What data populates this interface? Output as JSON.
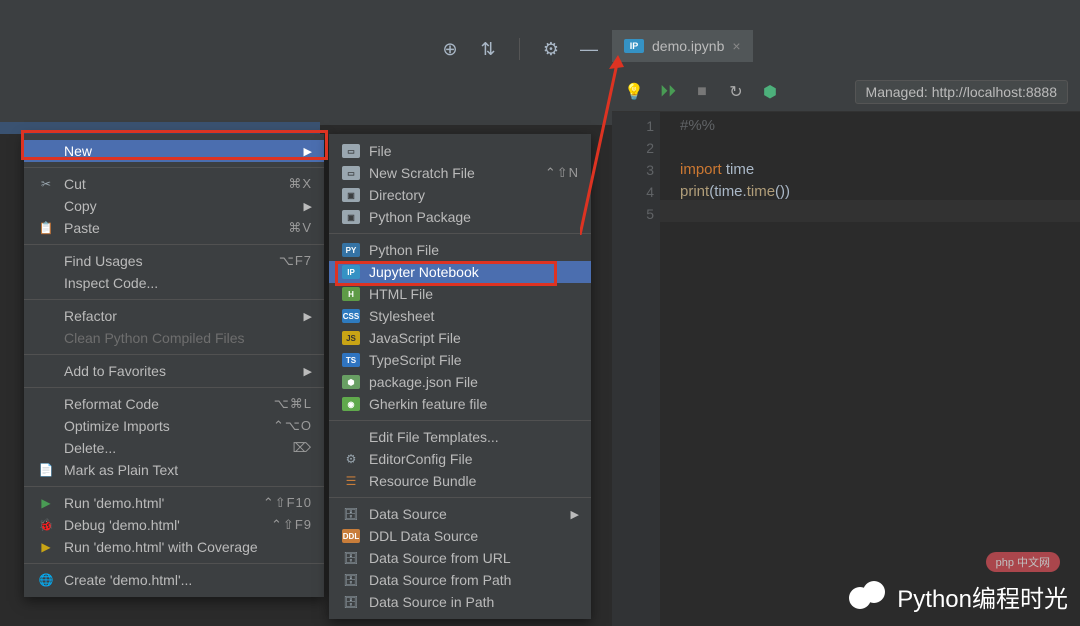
{
  "tab": {
    "filename": "demo.ipynb"
  },
  "managed": "Managed: http://localhost:8888",
  "code": {
    "line1": "#%%",
    "line3_kw": "import",
    "line3_mod": " time",
    "line4_fn": "print",
    "line4_open": "(",
    "line4_a": "time",
    "line4_dot1": ".",
    "line4_b": "time",
    "line4_call": "()",
    "line4_close": ")"
  },
  "lines": {
    "l1": "1",
    "l2": "2",
    "l3": "3",
    "l4": "4",
    "l5": "5"
  },
  "menu1": {
    "new": "New",
    "cut": "Cut",
    "cut_sc": "⌘X",
    "copy": "Copy",
    "paste": "Paste",
    "paste_sc": "⌘V",
    "find": "Find Usages",
    "find_sc": "⌥F7",
    "inspect": "Inspect Code...",
    "refactor": "Refactor",
    "clean": "Clean Python Compiled Files",
    "addfav": "Add to Favorites",
    "reformat": "Reformat Code",
    "reformat_sc": "⌥⌘L",
    "optimize": "Optimize Imports",
    "optimize_sc": "⌃⌥O",
    "delete": "Delete...",
    "delete_sc": "⌦",
    "plain": "Mark as Plain Text",
    "run": "Run 'demo.html'",
    "run_sc": "⌃⇧F10",
    "debug": "Debug 'demo.html'",
    "debug_sc": "⌃⇧F9",
    "coverage": "Run 'demo.html' with Coverage",
    "create": "Create 'demo.html'..."
  },
  "menu2": {
    "file": "File",
    "scratch": "New Scratch File",
    "scratch_sc": "⌃⇧N",
    "dir": "Directory",
    "pkg": "Python Package",
    "pyfile": "Python File",
    "jup": "Jupyter Notebook",
    "html": "HTML File",
    "css": "Stylesheet",
    "js": "JavaScript File",
    "ts": "TypeScript File",
    "pjson": "package.json File",
    "gherkin": "Gherkin feature file",
    "eft": "Edit File Templates...",
    "ecf": "EditorConfig File",
    "rb": "Resource Bundle",
    "ds": "Data Source",
    "ddl": "DDL Data Source",
    "dsurl": "Data Source from URL",
    "dspath": "Data Source from Path",
    "dsip": "Data Source in Path"
  },
  "watermark": "Python编程时光",
  "php": "php 中文网"
}
